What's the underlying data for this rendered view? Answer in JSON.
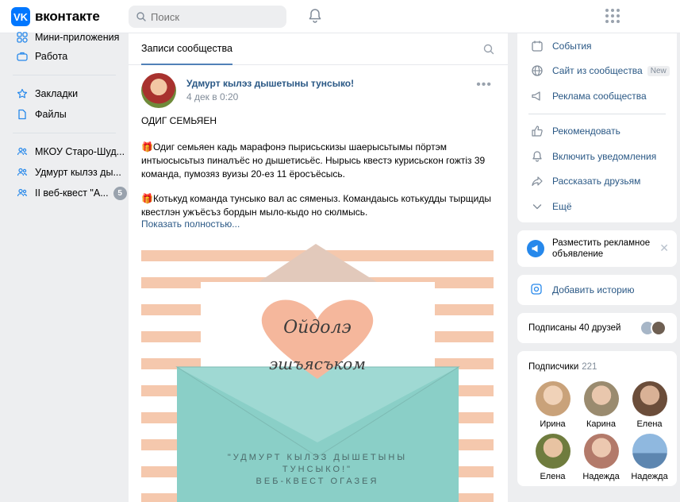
{
  "header": {
    "logo_text": "вконтакте",
    "logo_mark": "VK",
    "search_placeholder": "Поиск",
    "accent": "#0077ff"
  },
  "leftnav": {
    "items": [
      {
        "label": "Мини-приложения",
        "icon": "mini-apps-icon"
      },
      {
        "label": "Работа",
        "icon": "briefcase-icon"
      },
      {
        "label": "Закладки",
        "icon": "star-icon"
      },
      {
        "label": "Файлы",
        "icon": "file-icon"
      },
      {
        "label": "МКОУ Старо-Шуд...",
        "icon": "group-icon"
      },
      {
        "label": "Удмурт кылэз ды...",
        "icon": "group-icon"
      },
      {
        "label": "II веб-квест \"А...",
        "icon": "group-icon",
        "badge": "5"
      }
    ]
  },
  "feed": {
    "tab_label": "Записи сообщества",
    "post": {
      "author": "Удмурт кылэз дышетыны тунсыко!",
      "date": "4 дек в 0:20",
      "more": "•••",
      "heading": "ОДИГ СЕМЬЯЕН",
      "para1": "🎁Одиг семьяен кадь марафонэ пырисьскизы шаерысьтымы пöртэм интыосысьтыз пиналъёс но дышетисьёс. Нырысь квестэ курисьскон гожтiз 39 команда, пумозяз вуизы 20-ез 11 ёросъёсысь.",
      "para2": "🎁Котькуд команда тунсыко вал ас сяменыз. Командаысь котькудды тырщиды квестлэн ужъёсъз бордын мыло-кыдо но сюлмысь.",
      "show_more": "Показать полностью...",
      "image": {
        "heart_line1": "Ойдолэ",
        "heart_line2": "эшъясъком",
        "caption_line1": "\"УДМУРТ КЫЛЭЗ ДЫШЕТЫНЫ",
        "caption_line2": "ТУНСЫКО!\"",
        "caption_line3": "ВЕБ-КВЕСТ ОГАЗЕЯ"
      }
    }
  },
  "right": {
    "actions": [
      {
        "label": "События",
        "icon": "calendar-icon"
      },
      {
        "label": "Сайт из сообщества",
        "icon": "globe-icon",
        "tag": "New"
      },
      {
        "label": "Реклама сообщества",
        "icon": "megaphone-icon"
      },
      {
        "label": "Рекомендовать",
        "icon": "thumbs-up-icon"
      },
      {
        "label": "Включить уведомления",
        "icon": "bell-icon"
      },
      {
        "label": "Рассказать друзьям",
        "icon": "share-icon"
      },
      {
        "label": "Ещё",
        "icon": "chevron-down-icon"
      }
    ],
    "ad_text": "Разместить рекламное объявление",
    "ad_close": "✕",
    "story_label": "Добавить историю",
    "friends_text": "Подписаны 40 друзей",
    "subs_title": "Подписчики",
    "subs_count": "221",
    "subscribers": [
      {
        "name": "Ирина",
        "color": "#c9a27a"
      },
      {
        "name": "Карина",
        "color": "#9a8b6f"
      },
      {
        "name": "Елена",
        "color": "#6b4d3a"
      },
      {
        "name": "Елена",
        "color": "#6f7c3e"
      },
      {
        "name": "Надежда",
        "color": "#b37a6a"
      },
      {
        "name": "Надежда",
        "color": "#5d86b0"
      }
    ]
  }
}
